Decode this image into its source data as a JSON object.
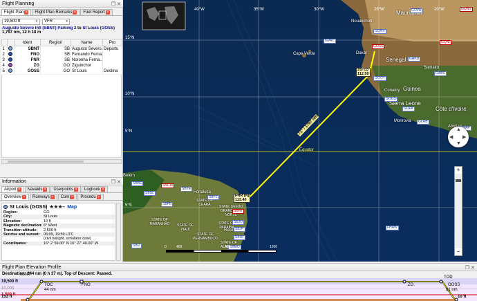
{
  "flight_planning": {
    "title": "Flight Planning",
    "tabs": [
      {
        "label": "Flight Plan",
        "active": true,
        "closable": true
      },
      {
        "label": "Flight Plan Remarks",
        "active": false,
        "closable": true
      },
      {
        "label": "Fuel Report",
        "active": false,
        "closable": true
      }
    ],
    "altitude": "19,500 ft",
    "rules": "VFR",
    "route_prefix": "Augusto Severo Intl (SBNT) Parking 2",
    "route_to": "to",
    "route_dest": "St Louis (GOSS)",
    "distance": "1,797 nm, 12 h 18 m",
    "columns": [
      "Ident",
      "Region",
      "Name",
      "Pro"
    ],
    "rows": [
      {
        "n": "1",
        "ident": "SBNT",
        "region": "SB",
        "name": "Augusto Severo...",
        "proc": "Departu"
      },
      {
        "n": "2",
        "ident": "FNO",
        "region": "SB",
        "name": "Fernando Ferna...",
        "proc": ""
      },
      {
        "n": "3",
        "ident": "FNR",
        "region": "SB",
        "name": "Noronha Ferna...",
        "proc": ""
      },
      {
        "n": "4",
        "ident": "ZG",
        "region": "GO",
        "name": "Ziguinchor",
        "proc": ""
      },
      {
        "n": "5",
        "ident": "GOSS",
        "region": "GO",
        "name": "St Louis",
        "proc": "Destina"
      }
    ]
  },
  "information": {
    "title": "Information",
    "tabs_row1": [
      "Airport",
      "Navaids",
      "Userpoints",
      "Logbook"
    ],
    "tabs_row2": [
      "Overview",
      "Runways",
      "Com",
      "Procedu"
    ],
    "airport_title": "St Louis (GOSS)",
    "stars": "★★★–",
    "map_link": "Map",
    "fields": [
      {
        "k": "Region:",
        "v": "GO"
      },
      {
        "k": "City:",
        "v": "St Louis"
      },
      {
        "k": "Elevation:",
        "v": "10 ft"
      },
      {
        "k": "Magnetic declination:",
        "v": "6° West"
      },
      {
        "k": "Transition altitude:",
        "v": "2,500 ft"
      },
      {
        "k": "Sunrise and sunset:",
        "v": "06:09, 19:59 UTC"
      },
      {
        "k": "",
        "v": "(civil twilight, simulator date)"
      },
      {
        "k": "Coordinates:",
        "v": "16° 2' 59.00\" N 16° 27' 40.00\" W"
      }
    ]
  },
  "map": {
    "longitudes": [
      "40°W",
      "35°W",
      "30°W",
      "25°W",
      "20°W"
    ],
    "latitudes": [
      "15°N",
      "10°N",
      "5°N",
      "5°S"
    ],
    "countries": [
      "Mauritania",
      "Senegal",
      "Guinea",
      "Sierra Leone",
      "Côte d'Ivoire",
      "Cape Verde"
    ],
    "cities": [
      "Nouakchott",
      "Dakar",
      "Bamako",
      "Conakry",
      "Monrovia",
      "Abidjan",
      "Fortaleza",
      "Recife",
      "Belém"
    ],
    "states": [
      "STATE OF MARANHÃO",
      "STATE OF PIAUÍ",
      "STATE OF CEARÁ",
      "STATE OF RIO GRANDE DO NORTE",
      "STATE OF PARAÍBA",
      "STATE OF PERNAMBUCO",
      "STATE OF ALAGOAS"
    ],
    "equator": "Equator",
    "route_label": "71° / 1797 nm",
    "route_start_label": "FNR (N)\n113.40",
    "route_end_label": "ZG (1)\n112.50",
    "scale": [
      "0",
      "400",
      "800",
      "1200"
    ],
    "airports": [
      "GVAC",
      "GOSS",
      "GOOY",
      "GQNV",
      "GOPA",
      "GQNS",
      "GQNI",
      "GAKD",
      "GABS",
      "GOGS",
      "GUFA",
      "GLRB",
      "DIAP",
      "SBNT",
      "SBTE",
      "SBFZ",
      "SBJU",
      "SBJP",
      "SBRF",
      "SBMO",
      "SBSL",
      "SBPB",
      "FHAW",
      "SNCW",
      "SBBE",
      "SBIZ"
    ]
  },
  "elevation": {
    "title": "Flight Plan Elevation Profile",
    "destination": "Destination: 244 nm (0 h 37 m). Top of Descent: Passed.",
    "alt_top": "19,500 ft",
    "alt_mid": "10,000",
    "alt_low": "1,500 ft",
    "alt_bottom": "153 ft",
    "dest_alt": "10 ft",
    "points": [
      "SBNT",
      "TOC",
      "FNO",
      "ZG",
      "TOD",
      "GOSS"
    ],
    "toc_dist": "44 nm",
    "tod_dist": "61 nm"
  },
  "colors": {
    "route": "#ffff00",
    "alt_line": "#d00000",
    "profile": "#000000"
  }
}
